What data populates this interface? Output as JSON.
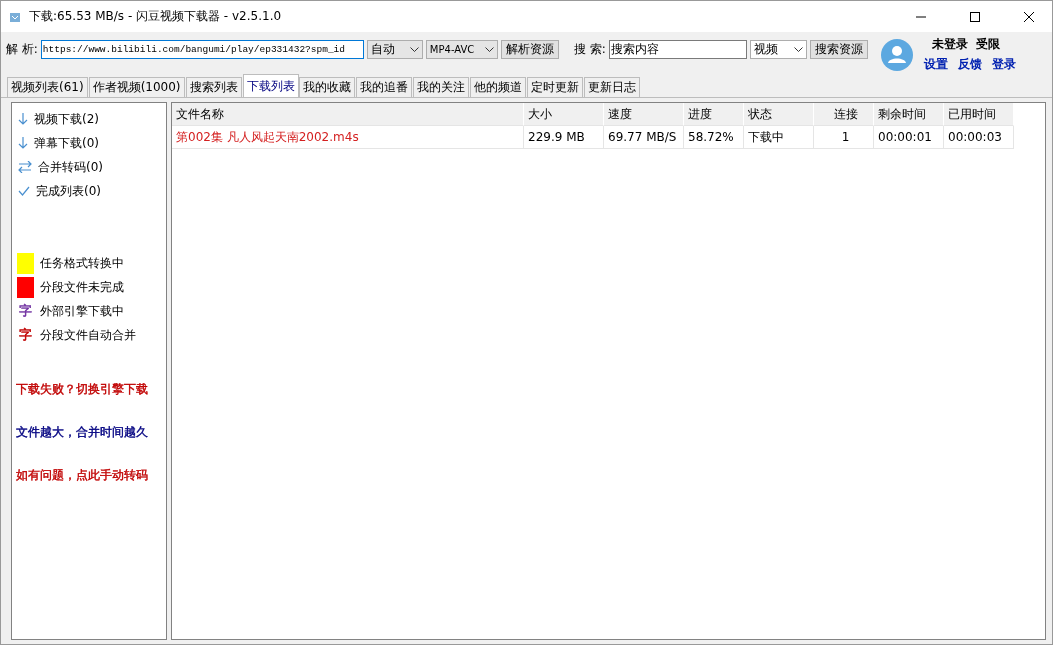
{
  "window": {
    "title": "下载:65.53 MB/s - 闪豆视频下载器 - v2.5.1.0"
  },
  "parse_bar": {
    "label": "解 析:",
    "url": "https://www.bilibili.com/bangumi/play/ep331432?spm_id",
    "quality": "自动",
    "format": "MP4-AVC",
    "button": "解析资源"
  },
  "search_bar": {
    "label": "搜 索:",
    "value": "搜索内容",
    "type": "视频",
    "button": "搜索资源"
  },
  "user": {
    "status": "未登录  受限",
    "links": [
      "设置",
      "反馈",
      "登录"
    ]
  },
  "tabs": [
    {
      "label": "视频列表(61)",
      "selected": false
    },
    {
      "label": "作者视频(1000)",
      "selected": false
    },
    {
      "label": "搜索列表",
      "selected": false
    },
    {
      "label": "下载列表",
      "selected": true
    },
    {
      "label": "我的收藏",
      "selected": false
    },
    {
      "label": "我的追番",
      "selected": false
    },
    {
      "label": "我的关注",
      "selected": false
    },
    {
      "label": "他的频道",
      "selected": false
    },
    {
      "label": "定时更新",
      "selected": false
    },
    {
      "label": "更新日志",
      "selected": false
    }
  ],
  "sidebar": {
    "items": [
      {
        "label": "视频下载(2)",
        "kind": "download"
      },
      {
        "label": "弹幕下载(0)",
        "kind": "download"
      },
      {
        "label": "合并转码(0)",
        "kind": "convert"
      },
      {
        "label": "完成列表(0)",
        "kind": "done"
      }
    ],
    "legend": [
      {
        "kind": "swatch",
        "color": "#ffff00",
        "label": "任务格式转换中"
      },
      {
        "kind": "swatch",
        "color": "#ff0000",
        "label": "分段文件未完成"
      },
      {
        "kind": "glyph",
        "glyph": "字",
        "color": "#7030a0",
        "label": "外部引擎下载中"
      },
      {
        "kind": "glyph",
        "glyph": "字",
        "color": "#c00000",
        "label": "分段文件自动合并"
      }
    ],
    "tips": [
      {
        "text": "下载失败？切换引擎下载",
        "color": "#c00000"
      },
      {
        "text": "文件越大，合并时间越久",
        "color": "#000080"
      },
      {
        "text": "如有问题，点此手动转码",
        "color": "#c00000"
      }
    ]
  },
  "table": {
    "columns": [
      "文件名称",
      "大小",
      "速度",
      "进度",
      "状态",
      "连接",
      "剩余时间",
      "已用时间"
    ],
    "rows": [
      {
        "cells": [
          "第002集 凡人风起天南2002.m4s",
          "229.9 MB",
          "69.77 MB/S",
          "58.72%",
          "下载中",
          "1",
          "00:00:01",
          "00:00:03"
        ],
        "color": "#d42020"
      }
    ]
  }
}
